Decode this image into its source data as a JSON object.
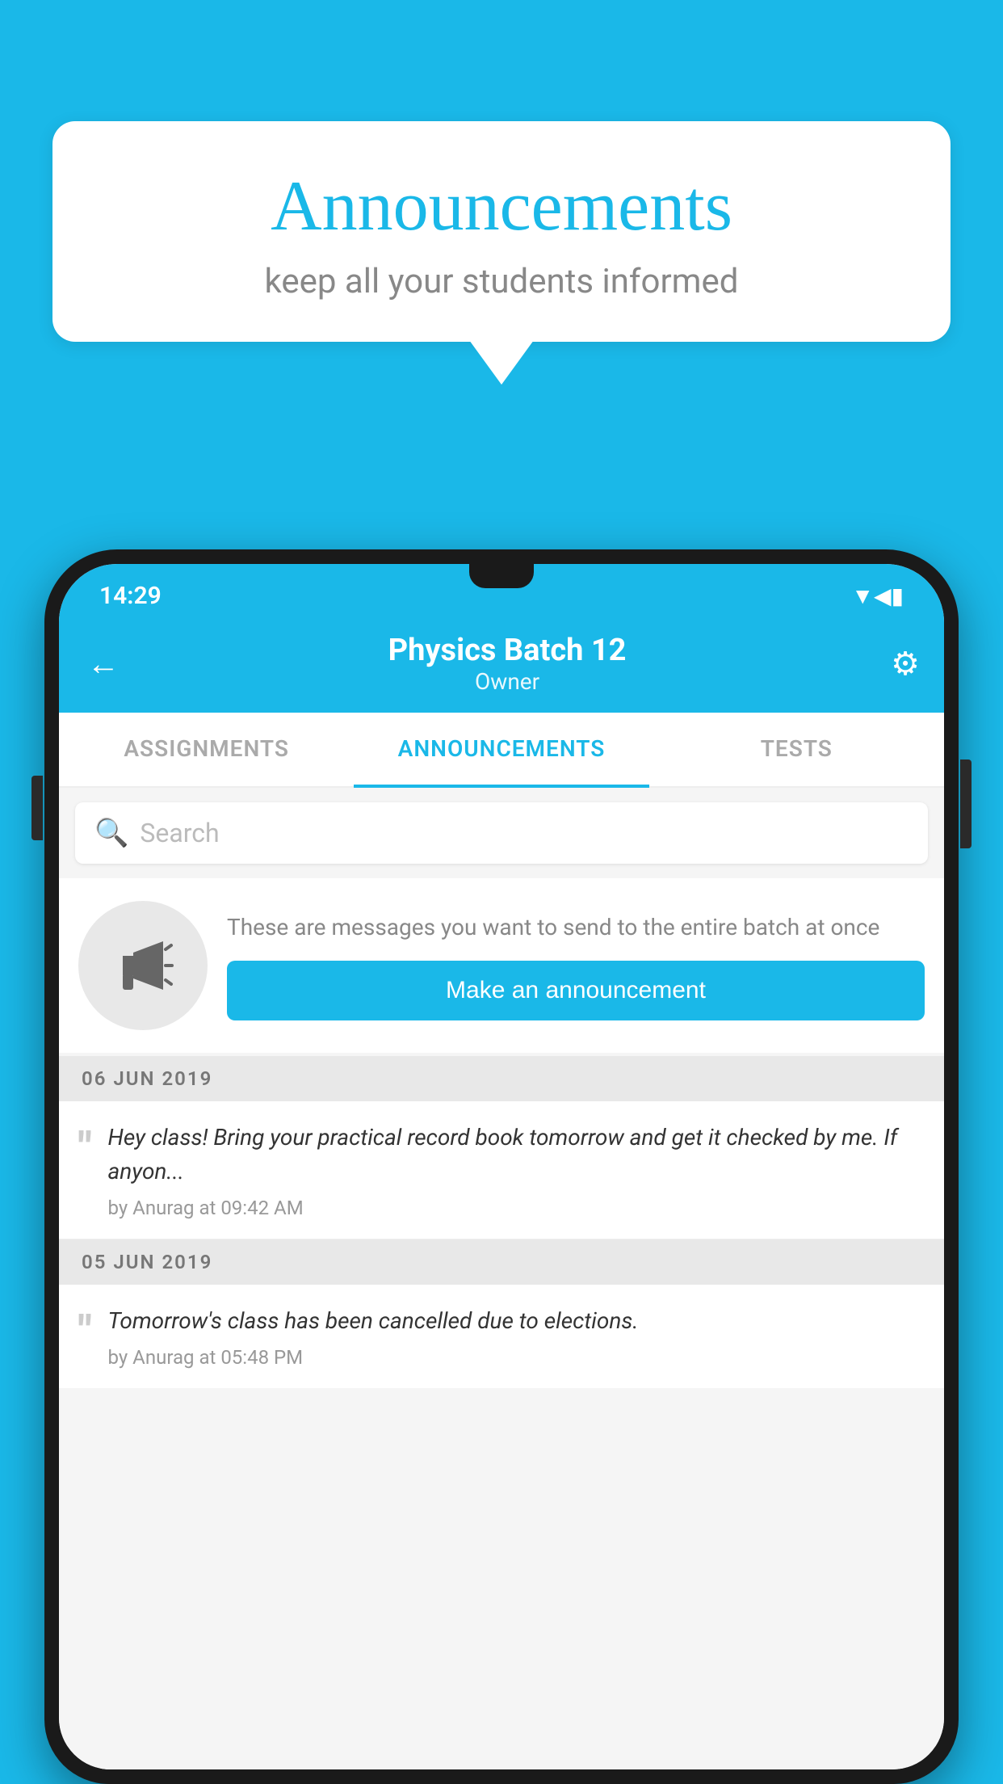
{
  "background_color": "#1ab8e8",
  "speech_bubble": {
    "title": "Announcements",
    "subtitle": "keep all your students informed"
  },
  "phone": {
    "status_bar": {
      "time": "14:29",
      "icons": [
        "wifi",
        "signal",
        "battery"
      ]
    },
    "app_bar": {
      "title": "Physics Batch 12",
      "subtitle": "Owner",
      "back_label": "←",
      "settings_label": "⚙"
    },
    "tabs": [
      {
        "label": "ASSIGNMENTS",
        "active": false
      },
      {
        "label": "ANNOUNCEMENTS",
        "active": true
      },
      {
        "label": "TESTS",
        "active": false
      }
    ],
    "search": {
      "placeholder": "Search"
    },
    "promo": {
      "description": "These are messages you want to send to the entire batch at once",
      "button_label": "Make an announcement"
    },
    "announcements": [
      {
        "date": "06  JUN  2019",
        "message": "Hey class! Bring your practical record book tomorrow and get it checked by me. If anyon...",
        "meta": "by Anurag at 09:42 AM"
      },
      {
        "date": "05  JUN  2019",
        "message": "Tomorrow's class has been cancelled due to elections.",
        "meta": "by Anurag at 05:48 PM"
      }
    ]
  }
}
